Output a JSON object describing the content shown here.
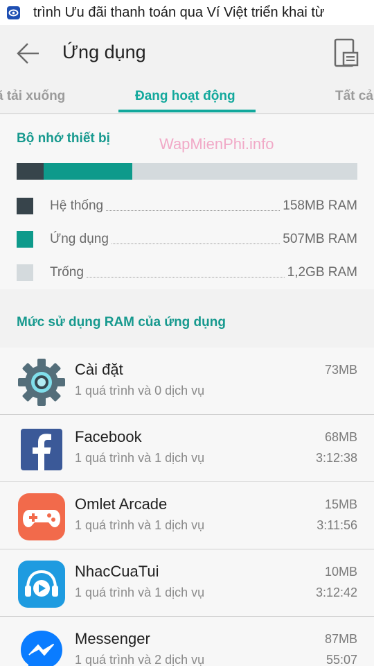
{
  "notification": {
    "text": "trình Ưu đãi thanh toán qua Ví Việt triển khai từ",
    "icon": "app-notification-icon"
  },
  "header": {
    "title": "Ứng dụng",
    "back_icon": "arrow-left-icon",
    "menu_icon": "device-memory-icon"
  },
  "tabs": [
    {
      "label": "ã tải xuống"
    },
    {
      "label": "Đang hoạt động",
      "active": true
    },
    {
      "label": "Tất cả"
    }
  ],
  "memory": {
    "title": "Bộ nhớ thiết bị",
    "watermark": "WapMienPhi.info",
    "legend": [
      {
        "label": "Hệ thống",
        "value": "158MB RAM",
        "color": "#37444b"
      },
      {
        "label": "Ứng dụng",
        "value": "507MB RAM",
        "color": "#0e9a8b"
      },
      {
        "label": "Trống",
        "value": "1,2GB RAM",
        "color": "#d4dadd"
      }
    ],
    "bar_fractions": {
      "system": 0.08,
      "apps": 0.26
    }
  },
  "ram_section": {
    "title": "Mức sử dụng RAM của ứng dụng"
  },
  "apps": [
    {
      "name": "Cài đặt",
      "desc": "1 quá trình và 0 dịch vụ",
      "size": "73MB",
      "time": "",
      "icon": "settings-gear-icon"
    },
    {
      "name": "Facebook",
      "desc": "1 quá trình và 1 dịch vụ",
      "size": "68MB",
      "time": "3:12:38",
      "icon": "facebook-icon"
    },
    {
      "name": "Omlet Arcade",
      "desc": "1 quá trình và 1 dịch vụ",
      "size": "15MB",
      "time": "3:11:56",
      "icon": "gamepad-icon"
    },
    {
      "name": "NhacCuaTui",
      "desc": "1 quá trình và 1 dịch vụ",
      "size": "10MB",
      "time": "3:12:42",
      "icon": "music-headphones-icon"
    },
    {
      "name": "Messenger",
      "desc": "1 quá trình và 2 dịch vụ",
      "size": "87MB",
      "time": "55:07",
      "icon": "messenger-icon"
    }
  ]
}
